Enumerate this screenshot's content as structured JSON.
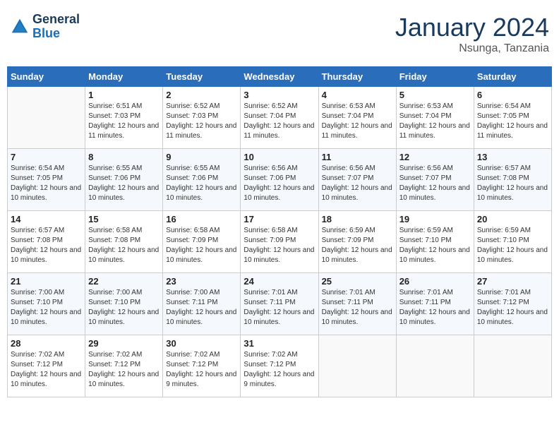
{
  "app": {
    "name": "GeneralBlue",
    "logo_line1": "General",
    "logo_line2": "Blue"
  },
  "calendar": {
    "month": "January 2024",
    "location": "Nsunga, Tanzania",
    "days_of_week": [
      "Sunday",
      "Monday",
      "Tuesday",
      "Wednesday",
      "Thursday",
      "Friday",
      "Saturday"
    ],
    "weeks": [
      [
        {
          "day": "",
          "sunrise": "",
          "sunset": "",
          "daylight": ""
        },
        {
          "day": "1",
          "sunrise": "Sunrise: 6:51 AM",
          "sunset": "Sunset: 7:03 PM",
          "daylight": "Daylight: 12 hours and 11 minutes."
        },
        {
          "day": "2",
          "sunrise": "Sunrise: 6:52 AM",
          "sunset": "Sunset: 7:03 PM",
          "daylight": "Daylight: 12 hours and 11 minutes."
        },
        {
          "day": "3",
          "sunrise": "Sunrise: 6:52 AM",
          "sunset": "Sunset: 7:04 PM",
          "daylight": "Daylight: 12 hours and 11 minutes."
        },
        {
          "day": "4",
          "sunrise": "Sunrise: 6:53 AM",
          "sunset": "Sunset: 7:04 PM",
          "daylight": "Daylight: 12 hours and 11 minutes."
        },
        {
          "day": "5",
          "sunrise": "Sunrise: 6:53 AM",
          "sunset": "Sunset: 7:04 PM",
          "daylight": "Daylight: 12 hours and 11 minutes."
        },
        {
          "day": "6",
          "sunrise": "Sunrise: 6:54 AM",
          "sunset": "Sunset: 7:05 PM",
          "daylight": "Daylight: 12 hours and 11 minutes."
        }
      ],
      [
        {
          "day": "7",
          "sunrise": "Sunrise: 6:54 AM",
          "sunset": "Sunset: 7:05 PM",
          "daylight": "Daylight: 12 hours and 10 minutes."
        },
        {
          "day": "8",
          "sunrise": "Sunrise: 6:55 AM",
          "sunset": "Sunset: 7:06 PM",
          "daylight": "Daylight: 12 hours and 10 minutes."
        },
        {
          "day": "9",
          "sunrise": "Sunrise: 6:55 AM",
          "sunset": "Sunset: 7:06 PM",
          "daylight": "Daylight: 12 hours and 10 minutes."
        },
        {
          "day": "10",
          "sunrise": "Sunrise: 6:56 AM",
          "sunset": "Sunset: 7:06 PM",
          "daylight": "Daylight: 12 hours and 10 minutes."
        },
        {
          "day": "11",
          "sunrise": "Sunrise: 6:56 AM",
          "sunset": "Sunset: 7:07 PM",
          "daylight": "Daylight: 12 hours and 10 minutes."
        },
        {
          "day": "12",
          "sunrise": "Sunrise: 6:56 AM",
          "sunset": "Sunset: 7:07 PM",
          "daylight": "Daylight: 12 hours and 10 minutes."
        },
        {
          "day": "13",
          "sunrise": "Sunrise: 6:57 AM",
          "sunset": "Sunset: 7:08 PM",
          "daylight": "Daylight: 12 hours and 10 minutes."
        }
      ],
      [
        {
          "day": "14",
          "sunrise": "Sunrise: 6:57 AM",
          "sunset": "Sunset: 7:08 PM",
          "daylight": "Daylight: 12 hours and 10 minutes."
        },
        {
          "day": "15",
          "sunrise": "Sunrise: 6:58 AM",
          "sunset": "Sunset: 7:08 PM",
          "daylight": "Daylight: 12 hours and 10 minutes."
        },
        {
          "day": "16",
          "sunrise": "Sunrise: 6:58 AM",
          "sunset": "Sunset: 7:09 PM",
          "daylight": "Daylight: 12 hours and 10 minutes."
        },
        {
          "day": "17",
          "sunrise": "Sunrise: 6:58 AM",
          "sunset": "Sunset: 7:09 PM",
          "daylight": "Daylight: 12 hours and 10 minutes."
        },
        {
          "day": "18",
          "sunrise": "Sunrise: 6:59 AM",
          "sunset": "Sunset: 7:09 PM",
          "daylight": "Daylight: 12 hours and 10 minutes."
        },
        {
          "day": "19",
          "sunrise": "Sunrise: 6:59 AM",
          "sunset": "Sunset: 7:10 PM",
          "daylight": "Daylight: 12 hours and 10 minutes."
        },
        {
          "day": "20",
          "sunrise": "Sunrise: 6:59 AM",
          "sunset": "Sunset: 7:10 PM",
          "daylight": "Daylight: 12 hours and 10 minutes."
        }
      ],
      [
        {
          "day": "21",
          "sunrise": "Sunrise: 7:00 AM",
          "sunset": "Sunset: 7:10 PM",
          "daylight": "Daylight: 12 hours and 10 minutes."
        },
        {
          "day": "22",
          "sunrise": "Sunrise: 7:00 AM",
          "sunset": "Sunset: 7:10 PM",
          "daylight": "Daylight: 12 hours and 10 minutes."
        },
        {
          "day": "23",
          "sunrise": "Sunrise: 7:00 AM",
          "sunset": "Sunset: 7:11 PM",
          "daylight": "Daylight: 12 hours and 10 minutes."
        },
        {
          "day": "24",
          "sunrise": "Sunrise: 7:01 AM",
          "sunset": "Sunset: 7:11 PM",
          "daylight": "Daylight: 12 hours and 10 minutes."
        },
        {
          "day": "25",
          "sunrise": "Sunrise: 7:01 AM",
          "sunset": "Sunset: 7:11 PM",
          "daylight": "Daylight: 12 hours and 10 minutes."
        },
        {
          "day": "26",
          "sunrise": "Sunrise: 7:01 AM",
          "sunset": "Sunset: 7:11 PM",
          "daylight": "Daylight: 12 hours and 10 minutes."
        },
        {
          "day": "27",
          "sunrise": "Sunrise: 7:01 AM",
          "sunset": "Sunset: 7:12 PM",
          "daylight": "Daylight: 12 hours and 10 minutes."
        }
      ],
      [
        {
          "day": "28",
          "sunrise": "Sunrise: 7:02 AM",
          "sunset": "Sunset: 7:12 PM",
          "daylight": "Daylight: 12 hours and 10 minutes."
        },
        {
          "day": "29",
          "sunrise": "Sunrise: 7:02 AM",
          "sunset": "Sunset: 7:12 PM",
          "daylight": "Daylight: 12 hours and 10 minutes."
        },
        {
          "day": "30",
          "sunrise": "Sunrise: 7:02 AM",
          "sunset": "Sunset: 7:12 PM",
          "daylight": "Daylight: 12 hours and 9 minutes."
        },
        {
          "day": "31",
          "sunrise": "Sunrise: 7:02 AM",
          "sunset": "Sunset: 7:12 PM",
          "daylight": "Daylight: 12 hours and 9 minutes."
        },
        {
          "day": "",
          "sunrise": "",
          "sunset": "",
          "daylight": ""
        },
        {
          "day": "",
          "sunrise": "",
          "sunset": "",
          "daylight": ""
        },
        {
          "day": "",
          "sunrise": "",
          "sunset": "",
          "daylight": ""
        }
      ]
    ]
  }
}
